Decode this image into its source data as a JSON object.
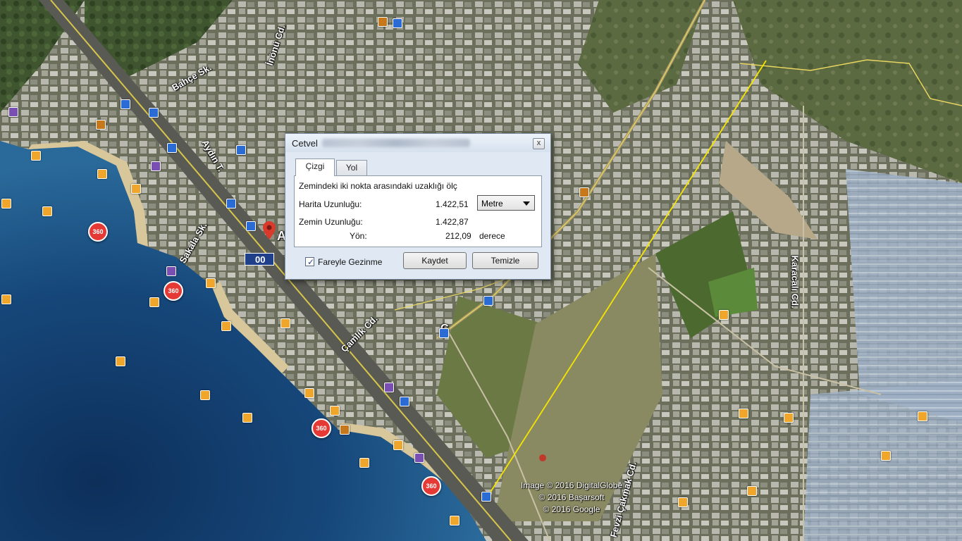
{
  "map": {
    "street_labels": [
      "Bahçe Sk.",
      "İnönü Cd.",
      "Aydın T.",
      "Sakala Sk.",
      "Çamlık Cd.",
      "Karacalı Cd.",
      "Fevzi Çakmak Cd.",
      "Ç"
    ],
    "pin_label": "AY",
    "badge_text": "00",
    "pin_360_label": "360",
    "copyright_lines": [
      "Image © 2016 DigitalGlobe",
      "© 2016 Başarsoft",
      "© 2016 Google"
    ],
    "measure_line_color": "#f5e400"
  },
  "dialog": {
    "title": "Cetvel",
    "close_glyph": "x",
    "tabs": [
      "Çizgi",
      "Yol"
    ],
    "description": "Zemindeki iki nokta arasındaki uzaklığı ölç",
    "map_length_label": "Harita Uzunluğu:",
    "map_length_value": "1.422,51",
    "unit": "Metre",
    "ground_length_label": "Zemin Uzunluğu:",
    "ground_length_value": "1.422,87",
    "heading_label": "Yön:",
    "heading_value": "212,09",
    "heading_unit": "derece",
    "mouse_nav_label": "Fareyle Gezinme",
    "mouse_nav_checked": true,
    "save_button": "Kaydet",
    "clear_button": "Temizle"
  }
}
